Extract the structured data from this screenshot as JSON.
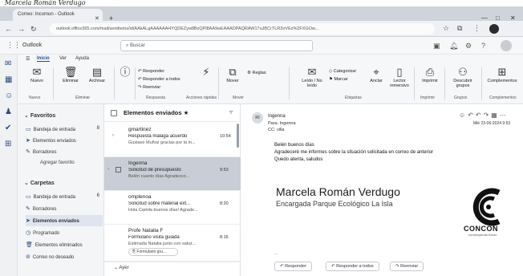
{
  "handwritten_caption": "Marcela Román Verdugo",
  "browser": {
    "tab_title": "Correo: Incomun - Outlook",
    "url": "outlook.office365.com/mail/sentitems/id/AAkALgAAAAAAHYQDEZyw8BzQPl8AA9wEAAADPAQRAW17uJBCrTLR3oVEz%2FXGOw...",
    "colors": {
      "tabbar": "#cfd3da",
      "addressbar": "#eef0f4"
    }
  },
  "outlook": {
    "brand": "Outlook",
    "search_placeholder": "Buscar"
  },
  "ribbon": {
    "tabs": [
      "Inicio",
      "Ver",
      "Ayuda"
    ],
    "active_tab": "Inicio",
    "buttons": {
      "new": "Nuevo",
      "delete": "Eliminar",
      "archive": "Archivar",
      "reply": "Responder",
      "reply_all": "Responder a todos",
      "forward": "Reenviar",
      "mover": "Mover",
      "rules": "Reglas",
      "read_unread": "Leído / No leído",
      "categorize": "Categorizar",
      "flag": "Marcar",
      "pin": "Anclar",
      "immersive_reader": "Lector inmersivo",
      "print": "Imprimir",
      "discover_groups": "Descubrir grupos",
      "complements": "Complementos"
    },
    "groups": [
      "Nuevo",
      "Eliminar",
      "Respuesta",
      "Acciones rápidas",
      "Mover",
      "Etiquetas",
      "Imprimir",
      "Grupos",
      "Complementos"
    ]
  },
  "folders": {
    "favorites_header": "Favoritos",
    "favorites": [
      {
        "label": "Bandeja de entrada",
        "count": "8"
      },
      {
        "label": "Elementos enviados",
        "count": ""
      },
      {
        "label": "Borradores",
        "count": ""
      }
    ],
    "add_favorite": "Agregar favorito",
    "folders_header": "Carpetas",
    "items": [
      {
        "label": "Bandeja de entrada",
        "count": "6"
      },
      {
        "label": "Borradores",
        "count": ""
      },
      {
        "label": "Elementos enviados",
        "count": ""
      },
      {
        "label": "Programado",
        "count": ""
      },
      {
        "label": "Elementos eliminados",
        "count": ""
      },
      {
        "label": "Correo no deseado",
        "count": ""
      }
    ]
  },
  "message_list": {
    "title": "Elementos enviados",
    "messages": [
      {
        "from": "gmartinez",
        "subject": "Respuesta malaga acuerdo",
        "time": "10:54",
        "preview": "Gustavo Muñoz gracias por la in..."
      },
      {
        "from": "Ingenna",
        "subject": "Solicitud de presupuesto",
        "time": "9:53",
        "preview": "Belén cuanto días Agradezco..."
      },
      {
        "from": "omplenoa",
        "subject": "Solicitud sobre material ext...",
        "time": "8:20",
        "preview": "Hola Camila buenos días! Agrade..."
      },
      {
        "from": "Profe Natalia F",
        "subject": "Formulario visita guiada",
        "time": "8:16",
        "preview": "Estimada Natalia junto con saluz..."
      }
    ],
    "attachment": "Formulario gru...",
    "group_label": "Ayer"
  },
  "reading": {
    "sender_initials": "RI",
    "from": "Ingenna",
    "to": "Para: Ingenna",
    "cc": "CC: villa",
    "date": "Mié 23-06-2024 9:53",
    "body": [
      "Belén buenos días",
      "Agradeceré me informes sobre la situación solicitada en correo de anterior",
      "Quedo atenta, saludos"
    ],
    "signature_name": "Marcela Román Verdugo",
    "signature_role": "Encargada Parque Ecológico La Isla",
    "logo_text": "CONCÓN",
    "logo_sub": "construyendo futuro",
    "ellipsis": "...",
    "reply": "Responder",
    "reply_all": "Responder a todos",
    "forward": "Reenviar"
  }
}
